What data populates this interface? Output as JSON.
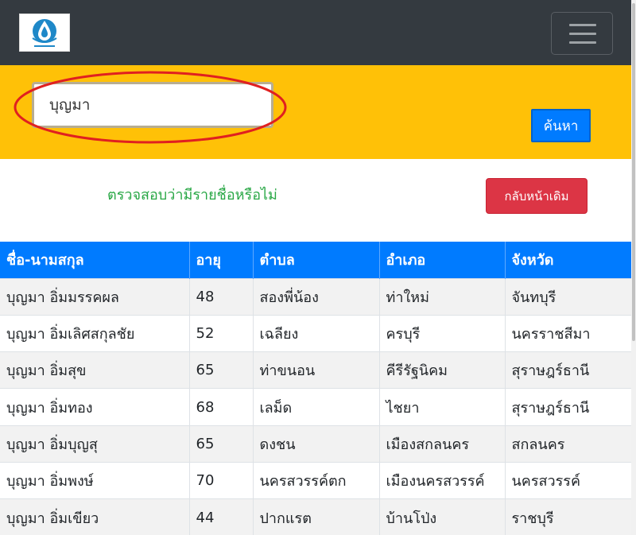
{
  "navbar": {
    "logo_icon": "water-drop-logo",
    "menu_icon": "hamburger-menu-icon",
    "background": "#343a40"
  },
  "search": {
    "value": "บุญมา",
    "button_label": "ค้นหา",
    "band_color": "#ffc107",
    "annotation_color": "#e02020"
  },
  "status": {
    "check_text": "ตรวจสอบว่ามีรายชื่อหรือไม่",
    "back_label": "กลับหน้าเดิม"
  },
  "table": {
    "headers": [
      "ชื่อ-นามสกุล",
      "อายุ",
      "ตำบล",
      "อำเภอ",
      "จังหวัด"
    ],
    "rows": [
      [
        "บุญมา อิ่มมรรคผล",
        "48",
        "สองพี่น้อง",
        "ท่าใหม่",
        "จันทบุรี"
      ],
      [
        "บุญมา อิ่มเลิศสกุลชัย",
        "52",
        "เฉลียง",
        "ครบุรี",
        "นครราชสีมา"
      ],
      [
        "บุญมา อิ่มสุข",
        "65",
        "ท่าขนอน",
        "คีรีรัฐนิคม",
        "สุราษฎร์ธานี"
      ],
      [
        "บุญมา อิ่มทอง",
        "68",
        "เลม็ด",
        "ไชยา",
        "สุราษฎร์ธานี"
      ],
      [
        "บุญมา อิ่มบุญสุ",
        "65",
        "ดงชน",
        "เมืองสกลนคร",
        "สกลนคร"
      ],
      [
        "บุญมา อิ่มพงษ์",
        "70",
        "นครสวรรค์ตก",
        "เมืองนครสวรรค์",
        "นครสวรรค์"
      ],
      [
        "บุญมา อิ่มเขียว",
        "44",
        "ปากแรต",
        "บ้านโป่ง",
        "ราชบุรี"
      ]
    ],
    "header_color": "#007bff"
  }
}
